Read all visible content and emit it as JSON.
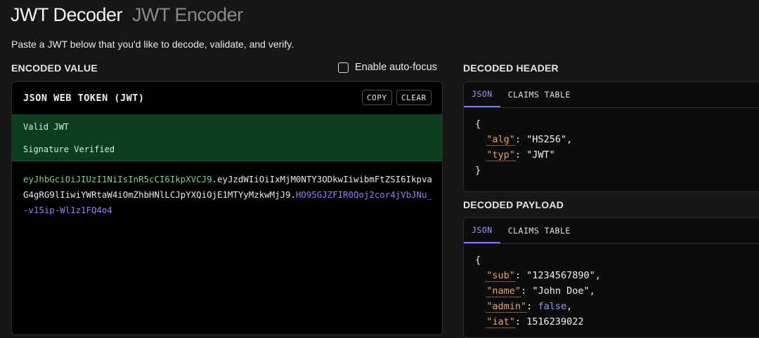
{
  "header": {
    "tabs": [
      "JWT Decoder",
      "JWT Encoder"
    ],
    "subtitle": "Paste a JWT below that you'd like to decode, validate, and verify."
  },
  "encoded": {
    "section_label": "ENCODED VALUE",
    "autofocus_label": "Enable auto-focus",
    "autofocus_checked": false,
    "panel_title": "JSON WEB TOKEN (JWT)",
    "copy_label": "COPY",
    "clear_label": "CLEAR",
    "status_valid": "Valid JWT",
    "status_signature": "Signature Verified",
    "token_header": "eyJhbGciOiJIUzI1NiIsInR5cCI6IkpXVCJ9",
    "token_payload": "eyJzdWIiOiIxMjM0NTY3ODkwIiwibmFtZSI6IkpvaG4gRG9lIiwiYWRtaW4iOmZhbHNlLCJpYXQiOjE1MTYyMzkwMjJ9",
    "token_signature": "HO95GJZFIR0Qoj2cor4jVbJNu_-v15ip-Wl1z1FQ4o4",
    "dot": "."
  },
  "decoded_header": {
    "section_label": "DECODED HEADER",
    "tab_json": "JSON",
    "tab_claims": "CLAIMS TABLE",
    "open_brace": "{",
    "close_brace": "}",
    "alg_key": "\"alg\"",
    "alg_val": "\"HS256\"",
    "typ_key": "\"typ\"",
    "typ_val": "\"JWT\""
  },
  "decoded_payload": {
    "section_label": "DECODED PAYLOAD",
    "tab_json": "JSON",
    "tab_claims": "CLAIMS TABLE",
    "open_brace": "{",
    "sub_key": "\"sub\"",
    "sub_val": "\"1234567890\"",
    "name_key": "\"name\"",
    "name_val": "\"John Doe\"",
    "admin_key": "\"admin\"",
    "admin_val": "false",
    "iat_key": "\"iat\"",
    "iat_val": "1516239022"
  },
  "colors": {
    "valid_bg": "#0b3d20",
    "header_segment": "#7fd08a",
    "signature_segment": "#8a84ff",
    "json_key": "#e6a36a",
    "active_tab": "#9b9bff"
  }
}
